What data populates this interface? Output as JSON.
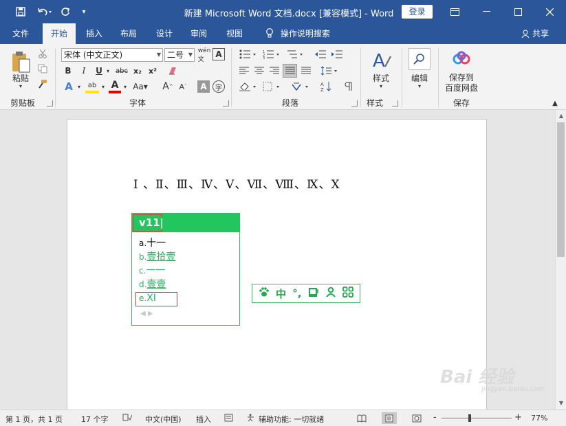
{
  "titlebar": {
    "title": "新建 Microsoft Word 文档.docx [兼容模式]  -  Word",
    "login": "登录",
    "quick_access": [
      "save-icon",
      "undo-icon",
      "redo-icon",
      "customize-icon"
    ]
  },
  "tabs": [
    {
      "label": "文件",
      "active": false
    },
    {
      "label": "开始",
      "active": true
    },
    {
      "label": "插入",
      "active": false
    },
    {
      "label": "布局",
      "active": false
    },
    {
      "label": "设计",
      "active": false
    },
    {
      "label": "审阅",
      "active": false
    },
    {
      "label": "视图",
      "active": false
    }
  ],
  "tell_me": "操作说明搜索",
  "share": "共享",
  "ribbon": {
    "clipboard": {
      "paste": "粘贴",
      "label": "剪贴板"
    },
    "font": {
      "family": "宋体 (中文正文)",
      "size": "二号",
      "label": "字体"
    },
    "paragraph": {
      "label": "段落"
    },
    "styles": {
      "button": "样式",
      "label": "样式"
    },
    "editing": {
      "button": "编辑"
    },
    "save": {
      "button_line1": "保存到",
      "button_line2": "百度网盘",
      "label": "保存"
    }
  },
  "document": {
    "roman_line": "Ⅰ 、Ⅱ、Ⅲ、Ⅳ、Ⅴ、Ⅶ、Ⅷ、Ⅸ、Ⅹ"
  },
  "ime": {
    "composition": "v11",
    "candidates": [
      {
        "key": "a.",
        "text": "十一"
      },
      {
        "key": "b.",
        "text": "壹拾壹"
      },
      {
        "key": "c.",
        "text": "一一"
      },
      {
        "key": "d.",
        "text": "壹壹"
      },
      {
        "key": "e.",
        "text": "XI"
      }
    ],
    "nav": "◀ ▶",
    "toolbar": [
      "paw",
      "中",
      "°,",
      "cup",
      "user",
      "grid"
    ],
    "toolbar_mode": "中",
    "toolbar_punct": "°,"
  },
  "status": {
    "page": "第 1 页，共 1 页",
    "words": "17 个字",
    "language": "中文(中国)",
    "insert": "插入",
    "accessibility": "辅助功能: 一切就绪",
    "zoom_minus": "-",
    "zoom_plus": "+",
    "zoom": "77%",
    "zoom_level": 0.77
  },
  "watermark": {
    "logo": "Bai 经验",
    "url": "jingyan.baidu.com"
  },
  "colors": {
    "accent": "#2b579a",
    "ime_green": "#22c55e",
    "highlight_red": "#e53935"
  }
}
